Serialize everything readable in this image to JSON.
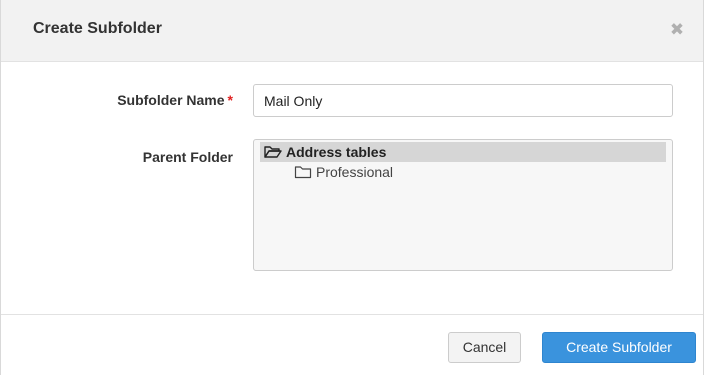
{
  "dialog": {
    "title": "Create Subfolder",
    "close_icon": "close-icon"
  },
  "form": {
    "name_label": "Subfolder Name",
    "required_mark": "*",
    "name_value": "Mail Only",
    "parent_label": "Parent Folder"
  },
  "folders": [
    {
      "label": "Address tables",
      "icon": "folder-open-icon",
      "selected": true
    },
    {
      "label": "Professional",
      "icon": "folder-icon",
      "selected": false
    }
  ],
  "footer": {
    "cancel_label": "Cancel",
    "create_label": "Create Subfolder"
  },
  "colors": {
    "primary": "#3a93dd",
    "required": "#e02020",
    "selected_bg": "#d6d6d6"
  }
}
